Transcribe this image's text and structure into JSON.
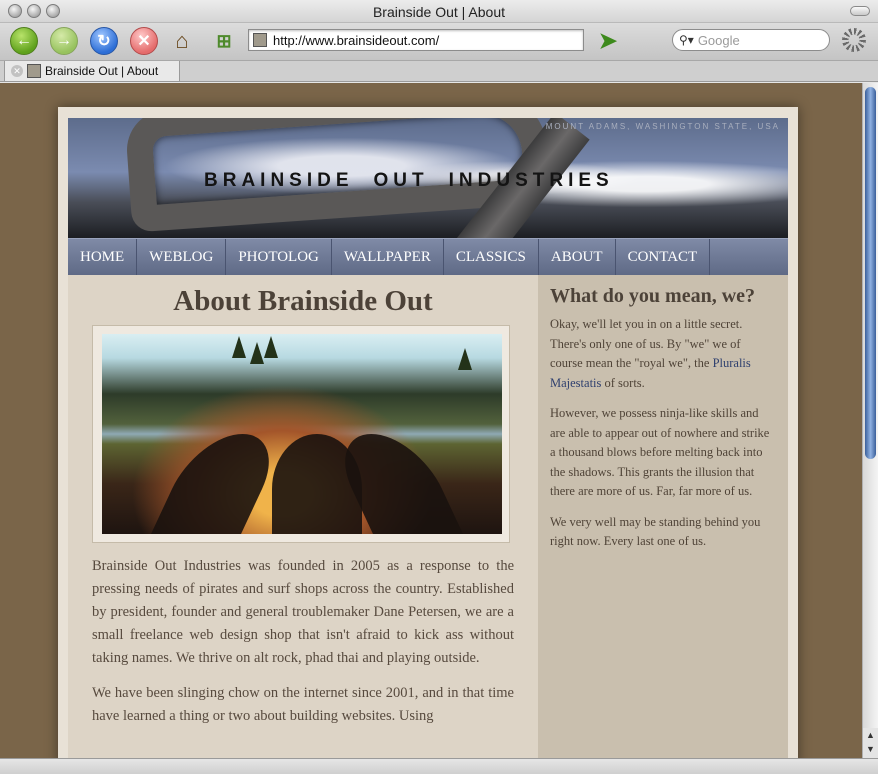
{
  "window": {
    "title": "Brainside Out | About"
  },
  "toolbar": {
    "url": "http://www.brainsideout.com/",
    "search_placeholder": "Google"
  },
  "tab": {
    "label": "Brainside Out | About"
  },
  "header": {
    "tagline": "MOUNT ADAMS, WASHINGTON STATE, USA",
    "brand_1": "BRAINSIDE",
    "brand_2": "OUT",
    "brand_3": "INDUSTRIES"
  },
  "nav": {
    "items": [
      {
        "label": "HOME"
      },
      {
        "label": "WEBLOG"
      },
      {
        "label": "PHOTOLOG"
      },
      {
        "label": "WALLPAPER"
      },
      {
        "label": "CLASSICS"
      },
      {
        "label": "ABOUT"
      },
      {
        "label": "CONTACT"
      }
    ]
  },
  "main": {
    "title": "About Brainside Out",
    "paragraphs": [
      "Brainside Out Industries was founded in 2005 as a response to the pressing needs of pirates and surf shops across the country. Established by president, founder and general troublemaker Dane Petersen, we are a small freelance web design shop that isn't afraid to kick ass without taking names. We thrive on alt rock, phad thai and playing outside.",
      "We have been slinging chow on the internet since 2001, and in that time have learned a thing or two about building websites. Using"
    ]
  },
  "sidebar": {
    "title": "What do you mean, we?",
    "p1_before": "Okay, we'll let you in on a little secret. There's only one of us. By \"we\" we of course mean the \"royal we\", the ",
    "p1_link": "Pluralis Majestatis",
    "p1_after": " of sorts.",
    "p2": "However, we possess ninja-like skills and are able to appear out of nowhere and strike a thousand blows before melting back into the shadows. This grants the illusion that there are more of us. Far, far more of us.",
    "p3": "We very well may be standing behind you right now. Every last one of us."
  },
  "icons": {
    "back": "back-arrow-icon",
    "forward": "forward-arrow-icon",
    "reload": "reload-icon",
    "stop": "stop-icon",
    "home": "home-icon",
    "add_bookmark": "add-bookmark-icon",
    "bookmark": "bookmark-icon",
    "search": "search-icon",
    "loading": "loading-spinner-icon"
  }
}
